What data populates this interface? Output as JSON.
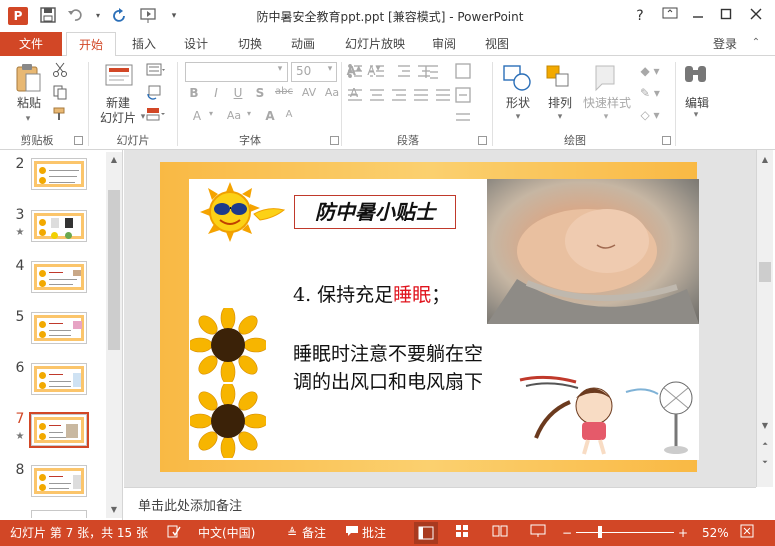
{
  "window": {
    "app_icon": "P",
    "title": "防中暑安全教育ppt.ppt [兼容模式] - PowerPoint",
    "help": "?",
    "login": "登录"
  },
  "tabs": {
    "file": "文件",
    "items": [
      "开始",
      "插入",
      "设计",
      "切换",
      "动画",
      "幻灯片放映",
      "审阅",
      "视图"
    ],
    "active": "开始"
  },
  "ribbon": {
    "clipboard": {
      "paste": "粘贴",
      "label": "剪贴板"
    },
    "slides": {
      "new_slide": "新建\n幻灯片",
      "new_slide_l1": "新建",
      "new_slide_l2": "幻灯片",
      "label": "幻灯片"
    },
    "font": {
      "size": "50",
      "label": "字体"
    },
    "paragraph": {
      "label": "段落"
    },
    "drawing": {
      "shapes": "形状",
      "arrange": "排列",
      "quick_styles": "快速样式",
      "label": "绘图"
    },
    "editing": {
      "edit": "编辑"
    }
  },
  "thumbnails": [
    {
      "num": "2",
      "star": false,
      "selected": false
    },
    {
      "num": "3",
      "star": true,
      "selected": false
    },
    {
      "num": "4",
      "star": false,
      "selected": false
    },
    {
      "num": "5",
      "star": false,
      "selected": false
    },
    {
      "num": "6",
      "star": false,
      "selected": false
    },
    {
      "num": "7",
      "star": true,
      "selected": true
    },
    {
      "num": "8",
      "star": false,
      "selected": false
    }
  ],
  "slide": {
    "title": "防中暑小贴士",
    "point_prefix": "4. 保持充足",
    "point_highlight": "睡眠",
    "point_suffix": "；",
    "body_line1": "睡眠时注意不要躺在空",
    "body_line2": "调的出风口和电风扇下"
  },
  "notes": {
    "placeholder": "单击此处添加备注"
  },
  "status": {
    "slide_info": "幻灯片 第 7 张，共 15 张",
    "language": "中文(中国)",
    "notes": "备注",
    "comments": "批注",
    "zoom": "52%"
  },
  "colors": {
    "accent": "#d24726",
    "slide_bg": "#f9b944",
    "highlight_text": "#e0141e"
  }
}
